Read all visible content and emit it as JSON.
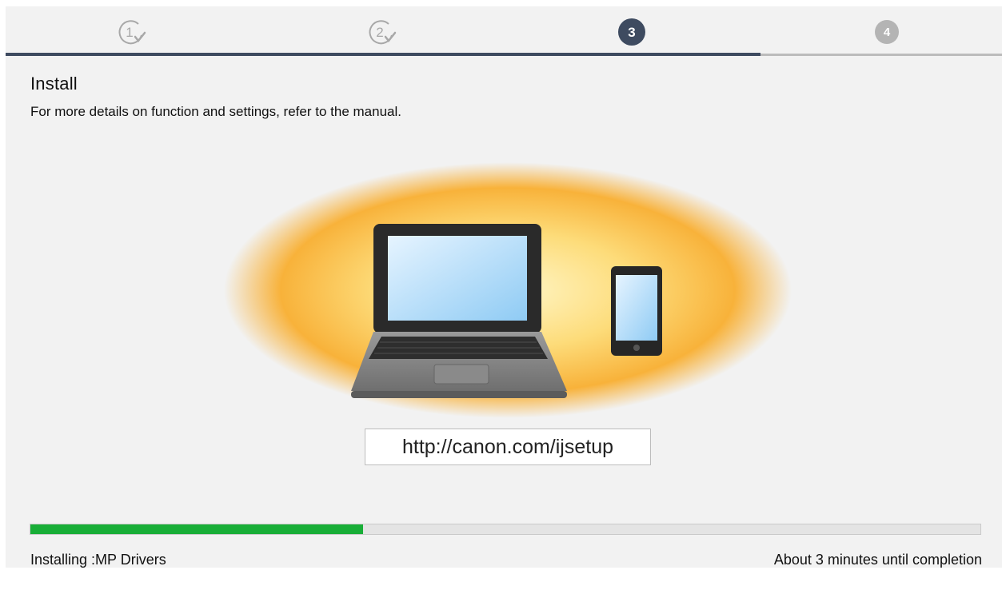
{
  "steps": [
    {
      "number": "1",
      "state": "completed",
      "icon": "check-icon"
    },
    {
      "number": "2",
      "state": "completed",
      "icon": "check-icon"
    },
    {
      "number": "3",
      "state": "current"
    },
    {
      "number": "4",
      "state": "pending"
    }
  ],
  "colors": {
    "step_current": "#3e4b60",
    "step_pending": "#b4b4b4",
    "step_completed_outline": "#a8a8a8",
    "track_done": "#3e4b60",
    "track_rest": "#bcbcbc",
    "progress_fill": "#18ae37",
    "background": "#f2f2f2",
    "glow": "#f8b23a"
  },
  "header": {
    "title": "Install",
    "subtitle": "For more details on function and settings, refer to the manual."
  },
  "illustration": {
    "items": [
      "laptop-icon",
      "smartphone-icon"
    ]
  },
  "url": "http://canon.com/ijsetup",
  "progress": {
    "fraction": 0.35,
    "status_label": "Installing :MP Drivers",
    "time_remaining": "About 3 minutes until completion"
  }
}
